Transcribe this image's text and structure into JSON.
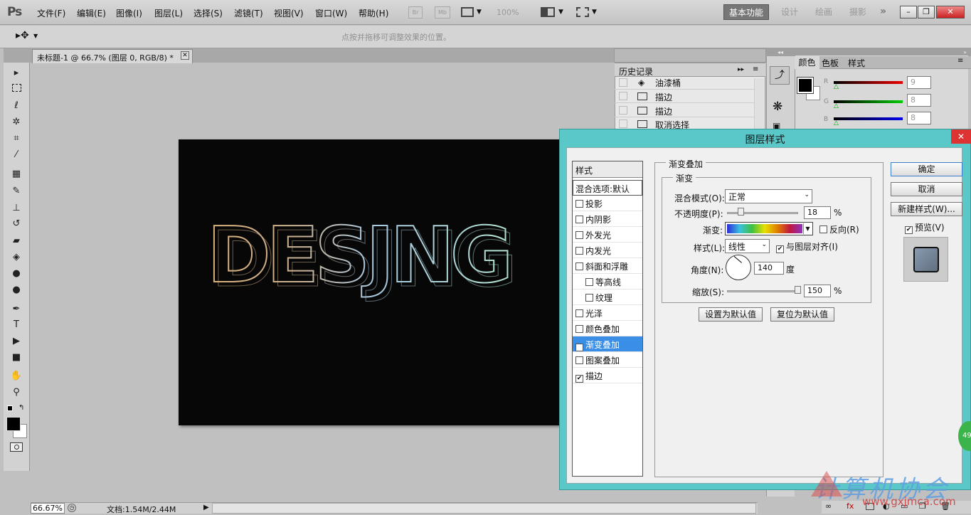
{
  "app": {
    "logo": "Ps"
  },
  "menu": [
    "文件(F)",
    "编辑(E)",
    "图像(I)",
    "图层(L)",
    "选择(S)",
    "滤镜(T)",
    "视图(V)",
    "窗口(W)",
    "帮助(H)"
  ],
  "toolbar": {
    "br": "Br",
    "mb": "Mb",
    "zoom": "100%"
  },
  "workspaces": {
    "active": "基本功能",
    "items": [
      "设计",
      "绘画",
      "摄影"
    ]
  },
  "options": {
    "hint": "点按并拖移可调整效果的位置。"
  },
  "document": {
    "tab": "未标题-1 @ 66.7% (图层 0, RGB/8) *"
  },
  "canvas_text": "DESJNG",
  "status": {
    "zoom": "66.67%",
    "doc": "文档:1.54M/2.44M"
  },
  "history": {
    "title": "历史记录",
    "rows": [
      "油漆桶",
      "描边",
      "描边",
      "取消选择"
    ]
  },
  "color_panel": {
    "tabs": [
      "颜色",
      "色板",
      "样式"
    ],
    "r": "9",
    "g": "8",
    "b": "8"
  },
  "dialog": {
    "title": "图层样式",
    "styles_header": "样式",
    "blend_options": "混合选项:默认",
    "items": [
      {
        "label": "投影",
        "checked": false
      },
      {
        "label": "内阴影",
        "checked": false
      },
      {
        "label": "外发光",
        "checked": false
      },
      {
        "label": "内发光",
        "checked": false
      },
      {
        "label": "斜面和浮雕",
        "checked": false
      },
      {
        "label": "等高线",
        "checked": false
      },
      {
        "label": "纹理",
        "checked": false
      },
      {
        "label": "光泽",
        "checked": false
      },
      {
        "label": "颜色叠加",
        "checked": false
      },
      {
        "label": "渐变叠加",
        "checked": true
      },
      {
        "label": "图案叠加",
        "checked": false
      },
      {
        "label": "描边",
        "checked": true
      }
    ],
    "section": "渐变叠加",
    "group": "渐变",
    "blend_mode_label": "混合模式(O):",
    "blend_mode": "正常",
    "opacity_label": "不透明度(P):",
    "opacity": "18",
    "gradient_label": "渐变:",
    "reverse_label": "反向(R)",
    "style_label": "样式(L):",
    "style_value": "线性",
    "align_label": "与图层对齐(I)",
    "angle_label": "角度(N):",
    "angle": "140",
    "degree": "度",
    "scale_label": "缩放(S):",
    "scale": "150",
    "percent": "%",
    "set_default": "设置为默认值",
    "reset_default": "复位为默认值",
    "ok": "确定",
    "cancel": "取消",
    "new_style": "新建样式(W)...",
    "preview": "预览(V)"
  },
  "watermark": {
    "text": "计算机协会",
    "url": "www.gxjmca.com"
  },
  "badge": "49"
}
